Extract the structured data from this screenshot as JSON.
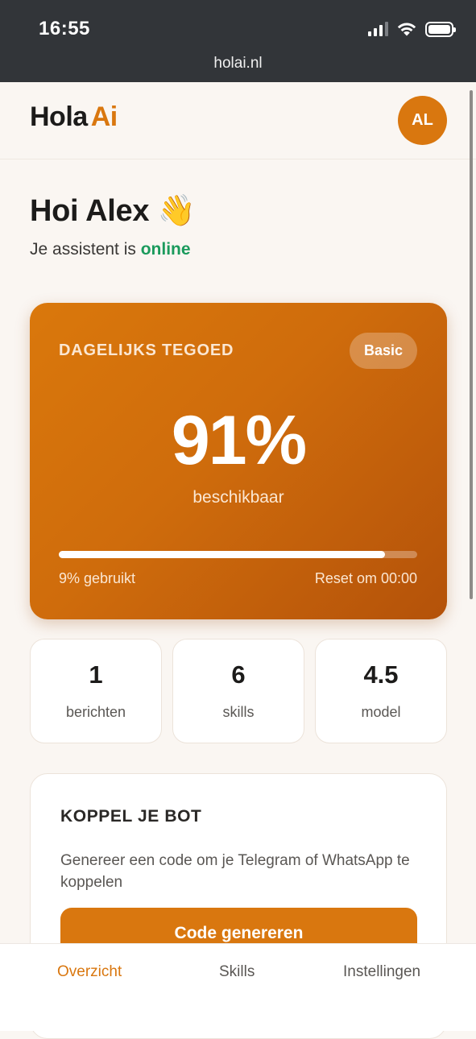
{
  "status_bar": {
    "time": "16:55",
    "url": "holai.nl",
    "icons": [
      "signal-icon",
      "wifi-icon",
      "battery-icon"
    ]
  },
  "header": {
    "logo_part1": "Hola",
    "logo_part2": "Ai",
    "avatar_initials": "AL"
  },
  "greeting": {
    "title": "Hoi Alex 👋",
    "status_prefix": "Je assistent is",
    "status_value": "online"
  },
  "credit_card": {
    "label": "DAGELIJKS TEGOED",
    "plan_badge": "Basic",
    "percent": "91%",
    "available_label": "beschikbaar",
    "available_fraction": 0.91,
    "used_label": "9% gebruikt",
    "reset_label": "Reset om 00:00"
  },
  "stats": [
    {
      "value": "1",
      "label": "berichten"
    },
    {
      "value": "6",
      "label": "skills"
    },
    {
      "value": "4.5",
      "label": "model"
    }
  ],
  "bot_card": {
    "title": "KOPPEL JE BOT",
    "description": "Genereer een code om je Telegram of WhatsApp te koppelen",
    "button_label": "Code genereren"
  },
  "nav": {
    "items": [
      {
        "label": "Overzicht",
        "active": true
      },
      {
        "label": "Skills",
        "active": false
      },
      {
        "label": "Instellingen",
        "active": false
      }
    ]
  },
  "colors": {
    "accent": "#d9770f",
    "online": "#1a9a5c",
    "background": "#faf6f2",
    "status_bar": "#323539"
  }
}
